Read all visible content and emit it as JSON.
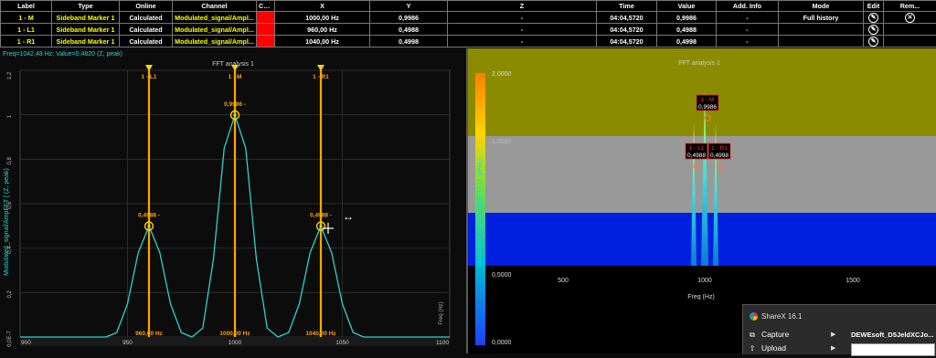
{
  "table": {
    "headers": [
      "Label",
      "Type",
      "Online",
      "Channel",
      "Col...",
      "X",
      "Y",
      "Z",
      "Time",
      "Value",
      "Add. Info",
      "Mode",
      "Edit",
      "Rem..."
    ],
    "rows": [
      {
        "label": "1 - M",
        "type": "Sideband Marker 1",
        "online": "Calculated",
        "channel": "Modulated_signal/Ampl...",
        "x": "1000,00 Hz",
        "y": "0,9986",
        "z": "-",
        "time": "04:04,5720",
        "value": "0,9986",
        "add_info": "-",
        "mode": "Full history"
      },
      {
        "label": "1 - L1",
        "type": "Sideband Marker 1",
        "online": "Calculated",
        "channel": "Modulated_signal/Ampl...",
        "x": "960,00 Hz",
        "y": "0,4988",
        "z": "-",
        "time": "04:04,5720",
        "value": "0,4988",
        "add_info": "-",
        "mode": ""
      },
      {
        "label": "1 - R1",
        "type": "Sideband Marker 1",
        "online": "Calculated",
        "channel": "Modulated_signal/Ampl...",
        "x": "1040,00 Hz",
        "y": "0,4998",
        "z": "-",
        "time": "04:04,5720",
        "value": "0,4998",
        "add_info": "-",
        "mode": ""
      }
    ],
    "row_color": "#ff0000"
  },
  "left_chart": {
    "readout": "Freq=1042,48 Hz; Value=0,4820  (Z, peak)",
    "title": "FFT analysis 1",
    "ylabel": "Modulated_signal/AmpFFT [ (Z, peak)",
    "xlabel": "Freq (Hz)",
    "y_ticks": [
      "1,2",
      "1",
      "0,8",
      "0,6",
      "0,4",
      "0,2",
      "0,0E-7"
    ],
    "x_ticks": [
      "900",
      "950",
      "1000",
      "1050",
      "1100"
    ],
    "markers": [
      {
        "label": "1 - L1",
        "value_label": "0,4988 -",
        "freq_label": "960,00 Hz",
        "freq": 960,
        "value": 0.4988
      },
      {
        "label": "1 - M",
        "value_label": "0,9986 -",
        "freq_label": "1000,00 Hz",
        "freq": 1000,
        "value": 0.9986
      },
      {
        "label": "1 - R1",
        "value_label": "0,4988 -",
        "freq_label": "1040,00 Hz",
        "freq": 1040,
        "value": 0.4988
      }
    ],
    "colors": {
      "line": "#29d3d3",
      "marker": "#ffa500"
    }
  },
  "chart_data": {
    "type": "line",
    "title": "FFT analysis 1",
    "xlabel": "Freq (Hz)",
    "ylabel": "Modulated_signal/AmpFFT [ (Z, peak)",
    "xlim": [
      900,
      1100
    ],
    "ylim": [
      0,
      1.2
    ],
    "x": [
      900,
      940,
      945,
      950,
      955,
      960,
      965,
      970,
      975,
      980,
      985,
      990,
      995,
      1000,
      1005,
      1010,
      1015,
      1020,
      1025,
      1030,
      1035,
      1040,
      1045,
      1050,
      1055,
      1060,
      1100
    ],
    "series": [
      {
        "values": [
          0,
          0,
          0.02,
          0.15,
          0.38,
          0.4988,
          0.38,
          0.15,
          0.02,
          0,
          0.04,
          0.35,
          0.85,
          0.9986,
          0.85,
          0.35,
          0.04,
          0,
          0.02,
          0.15,
          0.38,
          0.4988,
          0.38,
          0.15,
          0.02,
          0,
          0
        ]
      }
    ]
  },
  "right_chart": {
    "title": "FFT analysis 1",
    "ylabel": "Modulated_signal/AmpFFT [ (Z, peak)",
    "xlabel": "Freq (Hz)",
    "x_ticks": [
      "500",
      "1000",
      "1500"
    ],
    "scale_labels": [
      "2,0000",
      "1,0000",
      "0,5000",
      "0,0000"
    ],
    "bands": [
      "#8b8b00",
      "#999999",
      "#0020e0",
      "#000000"
    ],
    "markers": [
      {
        "label": "1 - M",
        "value": "0,9986"
      },
      {
        "label": "1 - L1",
        "value": "0,4988"
      },
      {
        "label": "1 - R1",
        "value": "0,4998"
      }
    ]
  },
  "popup": {
    "title": "ShareX 16.1",
    "items": [
      {
        "label": "Capture",
        "icon": "capture-icon"
      },
      {
        "label": "Upload",
        "icon": "upload-icon"
      }
    ],
    "filename": "DEWEsoft_D5JeldXCJo..."
  }
}
